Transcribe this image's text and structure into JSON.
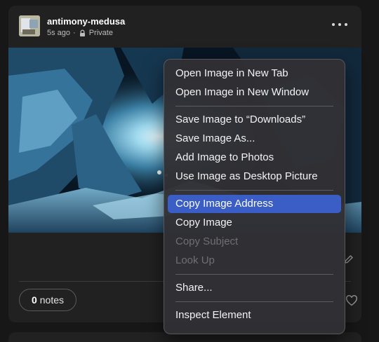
{
  "post": {
    "username": "antimony-medusa",
    "time": "5s ago",
    "separator": "·",
    "privacy": "Private",
    "notes_count": "0",
    "notes_label": "notes"
  },
  "context_menu": {
    "items": [
      {
        "label": "Open Image in New Tab",
        "state": "normal"
      },
      {
        "label": "Open Image in New Window",
        "state": "normal"
      },
      {
        "label": "Save Image to “Downloads”",
        "state": "normal"
      },
      {
        "label": "Save Image As...",
        "state": "normal"
      },
      {
        "label": "Add Image to Photos",
        "state": "normal"
      },
      {
        "label": "Use Image as Desktop Picture",
        "state": "normal"
      },
      {
        "label": "Copy Image Address",
        "state": "selected"
      },
      {
        "label": "Copy Image",
        "state": "normal"
      },
      {
        "label": "Copy Subject",
        "state": "disabled"
      },
      {
        "label": "Look Up",
        "state": "disabled"
      },
      {
        "label": "Share...",
        "state": "normal"
      },
      {
        "label": "Inspect Element",
        "state": "normal"
      }
    ]
  },
  "icons": {
    "lock": "lock-icon",
    "more": "ellipsis-icon",
    "edit": "pencil-icon",
    "like": "heart-icon"
  },
  "colors": {
    "menu_highlight": "#3a5dc6",
    "card_background": "#212121",
    "page_background": "#171717"
  }
}
